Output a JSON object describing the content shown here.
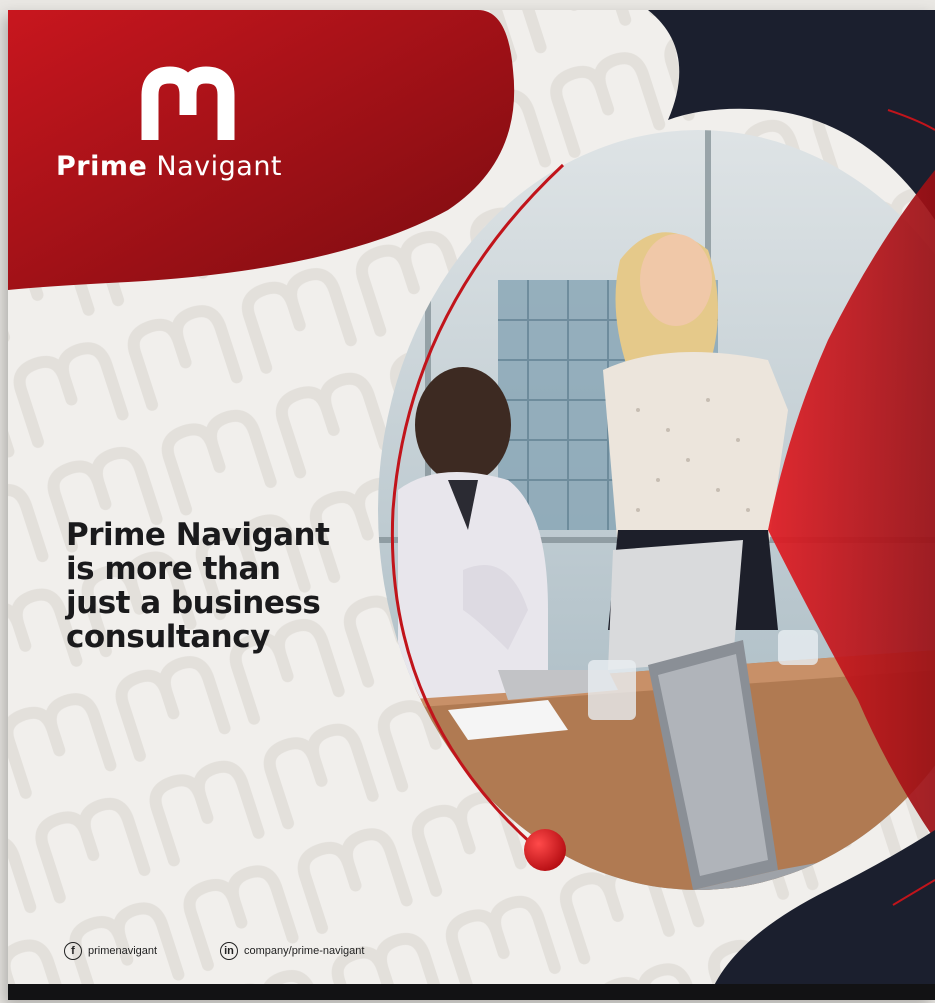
{
  "brand": {
    "name_bold": "Prime",
    "name_light": "Navigant",
    "logo_glyph": "pn"
  },
  "headline": [
    "Prime Navigant",
    "is more than",
    "just a business",
    "consultancy"
  ],
  "social": {
    "facebook": {
      "icon": "facebook-icon",
      "glyph": "f",
      "handle": "primenavigant"
    },
    "linkedin": {
      "icon": "linkedin-icon",
      "glyph": "in",
      "handle": "company/prime-navigant"
    }
  },
  "colors": {
    "brand_red": "#b3121a",
    "dark_navy": "#1b1f2e",
    "paper": "#f1efec",
    "text": "#1a1a1c"
  }
}
